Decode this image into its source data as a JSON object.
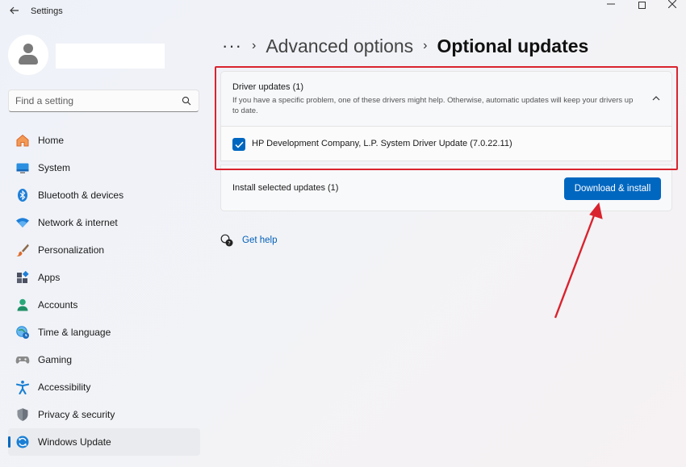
{
  "window": {
    "title": "Settings",
    "back_icon": "back-arrow-icon",
    "controls": [
      "minimize",
      "maximize",
      "close"
    ]
  },
  "search": {
    "placeholder": "Find a setting"
  },
  "sidebar": {
    "items": [
      {
        "label": "Home",
        "icon": "home-icon",
        "color": "#e8742e"
      },
      {
        "label": "System",
        "icon": "system-icon",
        "color": "#1e88d8"
      },
      {
        "label": "Bluetooth & devices",
        "icon": "bluetooth-icon",
        "color": "#1e7fd8"
      },
      {
        "label": "Network & internet",
        "icon": "wifi-icon",
        "color": "#1e7fd8"
      },
      {
        "label": "Personalization",
        "icon": "brush-icon",
        "color": "#d86a2a"
      },
      {
        "label": "Apps",
        "icon": "apps-icon",
        "color": "#555a66"
      },
      {
        "label": "Accounts",
        "icon": "person-icon",
        "color": "#2aa87a"
      },
      {
        "label": "Time & language",
        "icon": "globe-clock-icon",
        "color": "#1e88d8"
      },
      {
        "label": "Gaming",
        "icon": "gamepad-icon",
        "color": "#6e6e6e"
      },
      {
        "label": "Accessibility",
        "icon": "accessibility-icon",
        "color": "#1a7fd4"
      },
      {
        "label": "Privacy & security",
        "icon": "shield-icon",
        "color": "#7a8088"
      },
      {
        "label": "Windows Update",
        "icon": "windows-update-icon",
        "color": "#1a7fd4",
        "active": true
      }
    ]
  },
  "breadcrumb": {
    "more": "···",
    "sep": "›",
    "parent": "Advanced options",
    "current": "Optional updates"
  },
  "driver_updates": {
    "title": "Driver updates (1)",
    "description": "If you have a specific problem, one of these drivers might help. Otherwise, automatic updates will keep your drivers up to date.",
    "expanded": true,
    "items": [
      {
        "label": "HP Development Company, L.P. System Driver Update (7.0.22.11)",
        "checked": true
      }
    ]
  },
  "install": {
    "label": "Install selected updates (1)",
    "button": "Download & install"
  },
  "help": {
    "label": "Get help"
  },
  "colors": {
    "accent": "#0067c0",
    "annotation": "#d9232e"
  }
}
